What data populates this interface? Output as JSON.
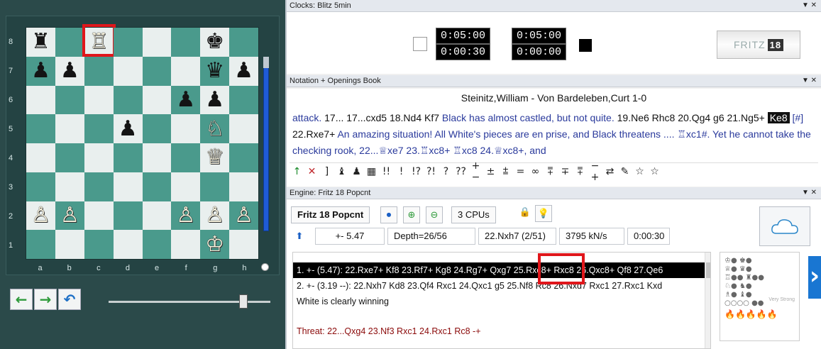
{
  "board": {
    "ranks": [
      "8",
      "7",
      "6",
      "5",
      "4",
      "3",
      "2",
      "1"
    ],
    "files": [
      "a",
      "b",
      "c",
      "d",
      "e",
      "f",
      "g",
      "h"
    ],
    "squares": [
      [
        "♜",
        "",
        "♖",
        "",
        "",
        "",
        "♚",
        ""
      ],
      [
        "♟",
        "♟",
        "",
        "",
        "",
        "",
        "♛",
        "♟"
      ],
      [
        "",
        "",
        "",
        "",
        "",
        "♟",
        "♟",
        ""
      ],
      [
        "",
        "",
        "",
        "♟",
        "",
        "",
        "♘",
        ""
      ],
      [
        "",
        "",
        "",
        "",
        "",
        "",
        "♕",
        ""
      ],
      [
        "",
        "",
        "",
        "",
        "",
        "",
        "",
        ""
      ],
      [
        "♙",
        "♙",
        "",
        "",
        "",
        "♙",
        "♙",
        "♙"
      ],
      [
        "",
        "",
        "",
        "",
        "",
        "",
        "♔",
        ""
      ]
    ],
    "highlight_square": "c8",
    "nav": {
      "back_icon": "arrow-left-icon",
      "forward_icon": "arrow-right-icon",
      "undo_icon": "undo-icon"
    },
    "colors": {
      "light": "#e9efee",
      "dark": "#4a9a8c",
      "highlight": "#e0161b"
    }
  },
  "clocks": {
    "title": "Clocks: Blitz 5min",
    "white_time": "0:05:00",
    "black_time": "0:05:00",
    "white_move_time": "0:00:30",
    "black_move_time": "0:00:00",
    "logo_text": "FRITZ",
    "logo_version": "18"
  },
  "notation": {
    "title": "Notation + Openings Book",
    "game_title": "Steinitz,William - Von Bardeleben,Curt  1-0",
    "segments": [
      {
        "t": "attack. ",
        "k": "cmt"
      },
      {
        "t": "17... 17...cxd5 18.Nd4 Kf7 ",
        "k": "mv"
      },
      {
        "t": "Black has almost castled, but not quite. ",
        "k": "cmt"
      },
      {
        "t": "19.Ne6 Rhc8 20.Qg4 g6 21.Ng5+ ",
        "k": "mv"
      },
      {
        "t": "Ke8",
        "k": "cur"
      },
      {
        "t": " [#] ",
        "k": "cmt"
      },
      {
        "t": "22.Rxe7+ ",
        "k": "mv"
      },
      {
        "t": "An amazing situation! All White's pieces are en prise, and Black threatens .... ♖xc1#. Yet he cannot take the checking rook, 22...♕xe7 23.♖xc8+ ♖xc8 24.♕xc8+, and",
        "k": "cmt"
      }
    ],
    "symbols": [
      "↑",
      "✕",
      "]",
      "♝",
      "♟",
      "▦",
      "!!",
      "!",
      "!?",
      "?!",
      "?",
      "??",
      "+−",
      "±",
      "⩲",
      "=",
      "∞",
      "⩱",
      "∓",
      "⩱",
      "−+",
      "⇄",
      "✎",
      "☆",
      "☆"
    ]
  },
  "engine": {
    "title": "Engine: Fritz 18 Popcnt",
    "name": "Fritz 18 Popcnt",
    "cpus": "3 CPUs",
    "eval": "+- 5.47",
    "depth": "Depth=26/56",
    "current_move": "22.Nxh7 (2/51)",
    "speed": "3795 kN/s",
    "time": "0:00:30",
    "lines": [
      "1. +- (5.47): 22.Rxe7+ Kf8 23.Rf7+ Kg8 24.Rg7+ Qxg7 25.Rxc8+ Rxc8 26.Qxc8+ Qf8 27.Qe6",
      "2. +- (3.19 --): 22.Nxh7 Kd8 23.Qf4 Rxc1 24.Qxc1 g5 25.Nf8 Rc8 26.Nxd7 Rxc1 27.Rxc1 Kxd",
      "White is clearly winning",
      "Threat: 22...Qxg4 23.Nf3 Rxc1 24.Rxc1 Rc8 -+"
    ],
    "very_strong_label": "Very Strong"
  }
}
